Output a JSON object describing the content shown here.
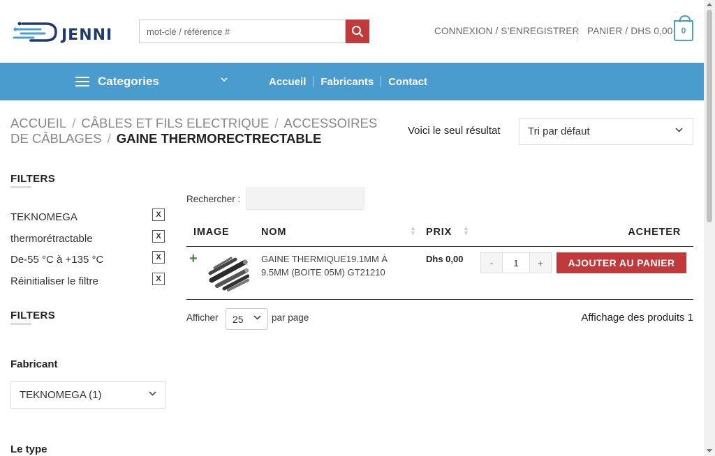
{
  "header": {
    "logo_text": "JENNI",
    "search_placeholder": "mot-clé / référence #",
    "account_label": "CONNEXION / S’ENREGISTRER",
    "cart_label": "PANIER / DHS 0,00",
    "cart_count": "0"
  },
  "nav": {
    "categories_label": "Categories",
    "links": [
      "Accueil",
      "Fabricants",
      "Contact"
    ]
  },
  "breadcrumb": {
    "items": [
      "ACCUEIL",
      "CÂBLES ET FILS ELECTRIQUE",
      "ACCESSOIRES DE CÂBLAGES"
    ],
    "current": "GAINE THERMORECTRECTABLE",
    "separator": "/"
  },
  "toolbar": {
    "result_text": "Voici le seul résultat",
    "sort_value": "Tri par défaut"
  },
  "sidebar": {
    "active_filters_title": "FILTERS",
    "active_filters": [
      "TEKNOMEGA",
      "thermorétractable",
      "De-55 °C à +135 °C",
      "Réinitialiser le filtre"
    ],
    "remove_label": "X",
    "filters_title": "FILTERS",
    "fabricant_label": "Fabricant",
    "fabricant_value": "TEKNOMEGA (1)",
    "type_label": "Le type"
  },
  "table": {
    "search_label": "Rechercher :",
    "columns": [
      "IMAGE",
      "NOM",
      "PRIX",
      "ACHETER"
    ],
    "rows": [
      {
        "expand": "+",
        "name": "GAINE THERMIQUE19.1mm à 9.5mm (BOITE 05M) GT21210",
        "price": "Dhs 0,00",
        "qty_minus": "-",
        "qty": "1",
        "qty_plus": "+",
        "add_label": "AJOUTER AU PANIER"
      }
    ],
    "show_label": "Afficher",
    "per_page_value": "25",
    "per_page_suffix": "par page",
    "info": "Affichage des produits 1"
  },
  "colors": {
    "nav_bg": "#4a9bce",
    "accent_red": "#c0393b",
    "cart_blue": "#4a9fd0"
  }
}
